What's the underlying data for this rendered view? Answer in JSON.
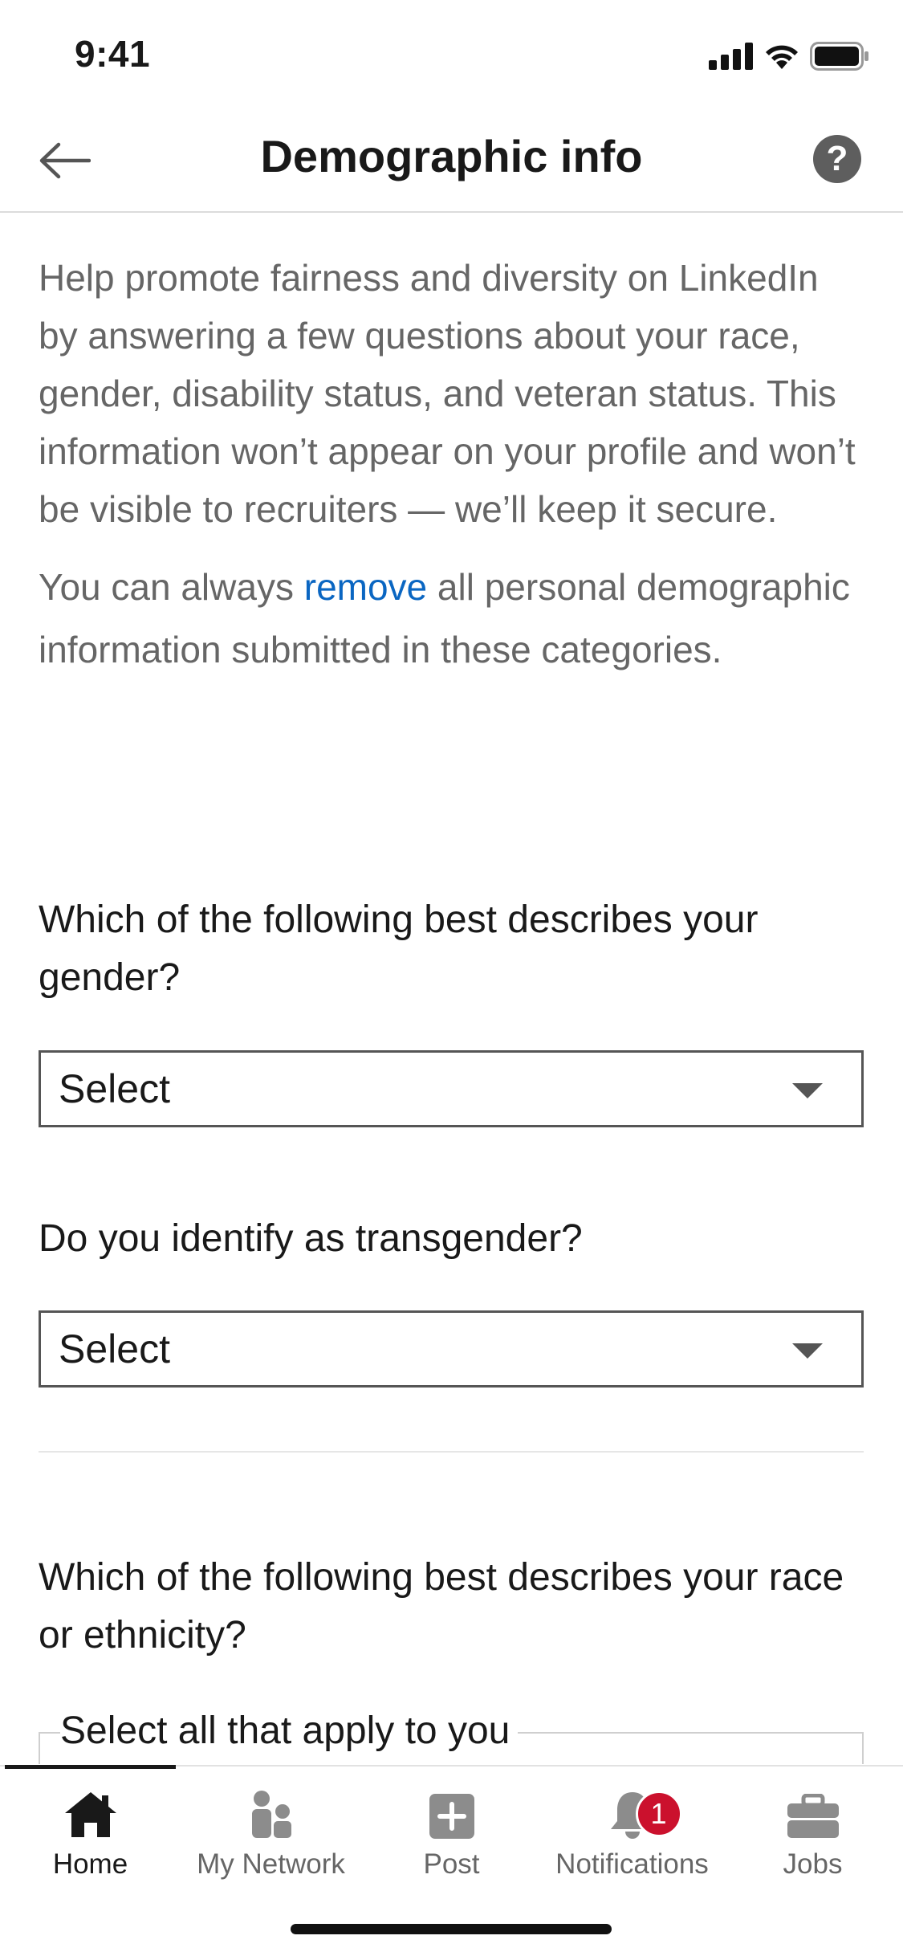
{
  "status_bar": {
    "time": "9:41"
  },
  "header": {
    "title": "Demographic info",
    "help_label": "?"
  },
  "intro": {
    "paragraph1": "Help promote fairness and diversity on LinkedIn by answering a few questions about your race, gender, disability status, and veteran status. This information won’t appear on your profile and won’t be visible to recruiters — we’ll keep it secure.",
    "paragraph2_before": "You can always ",
    "paragraph2_link": "remove",
    "paragraph2_after": " all personal demographic information submitted in these categories."
  },
  "questions": [
    {
      "label": "Which of the following best describes your gender?",
      "value": "Select"
    },
    {
      "label": "Do you identify as transgender?",
      "value": "Select"
    },
    {
      "label": "Which of the following best describes your race or ethnicity?",
      "hint": "Select all that apply to you"
    }
  ],
  "tab_bar": {
    "items": [
      {
        "label": "Home",
        "icon": "home-icon",
        "active": true
      },
      {
        "label": "My Network",
        "icon": "people-icon"
      },
      {
        "label": "Post",
        "icon": "plus-square-icon"
      },
      {
        "label": "Notifications",
        "icon": "bell-icon",
        "badge": "1"
      },
      {
        "label": "Jobs",
        "icon": "briefcase-icon"
      }
    ]
  },
  "colors": {
    "link": "#0a66c2",
    "badge": "#cb112d",
    "muted_text": "#666666"
  }
}
